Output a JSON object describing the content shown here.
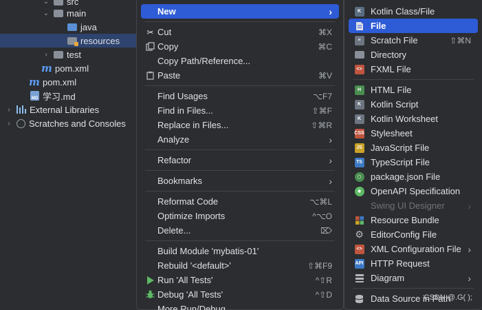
{
  "tree": {
    "items": [
      {
        "label": "src"
      },
      {
        "label": "main"
      },
      {
        "label": "java"
      },
      {
        "label": "resources"
      },
      {
        "label": "test"
      },
      {
        "label": "pom.xml"
      },
      {
        "label": "pom.xml"
      },
      {
        "label": "学习.md"
      },
      {
        "label": "External Libraries"
      },
      {
        "label": "Scratches and Consoles"
      }
    ]
  },
  "menu": {
    "new": {
      "label": "New"
    },
    "cut": {
      "label": "Cut",
      "shortcut": "⌘X"
    },
    "copy": {
      "label": "Copy",
      "shortcut": "⌘C"
    },
    "copy_path": {
      "label": "Copy Path/Reference..."
    },
    "paste": {
      "label": "Paste",
      "shortcut": "⌘V"
    },
    "find_usages": {
      "label": "Find Usages",
      "shortcut": "⌥F7"
    },
    "find_in_files": {
      "label": "Find in Files...",
      "shortcut": "⇧⌘F"
    },
    "replace_in_files": {
      "label": "Replace in Files...",
      "shortcut": "⇧⌘R"
    },
    "analyze": {
      "label": "Analyze"
    },
    "refactor": {
      "label": "Refactor"
    },
    "bookmarks": {
      "label": "Bookmarks"
    },
    "reformat": {
      "label": "Reformat Code",
      "shortcut": "⌥⌘L"
    },
    "optimize": {
      "label": "Optimize Imports",
      "shortcut": "^⌥O"
    },
    "delete": {
      "label": "Delete...",
      "shortcut": "⌦"
    },
    "build_module": {
      "label": "Build Module 'mybatis-01'"
    },
    "rebuild": {
      "label": "Rebuild '<default>'",
      "shortcut": "⇧⌘F9"
    },
    "run_tests": {
      "label": "Run 'All Tests'",
      "shortcut": "^⇧R"
    },
    "debug_tests": {
      "label": "Debug 'All Tests'",
      "shortcut": "^⇧D"
    },
    "more_run": {
      "label": "More Run/Debug"
    }
  },
  "submenu": {
    "kotlin_class": {
      "label": "Kotlin Class/File"
    },
    "file": {
      "label": "File"
    },
    "scratch": {
      "label": "Scratch File",
      "shortcut": "⇧⌘N"
    },
    "directory": {
      "label": "Directory"
    },
    "fxml": {
      "label": "FXML File"
    },
    "html": {
      "label": "HTML File"
    },
    "kotlin_script": {
      "label": "Kotlin Script"
    },
    "kotlin_worksheet": {
      "label": "Kotlin Worksheet"
    },
    "stylesheet": {
      "label": "Stylesheet"
    },
    "javascript": {
      "label": "JavaScript File"
    },
    "typescript": {
      "label": "TypeScript File"
    },
    "package_json": {
      "label": "package.json File"
    },
    "openapi": {
      "label": "OpenAPI Specification"
    },
    "swing": {
      "label": "Swing UI Designer"
    },
    "resource_bundle": {
      "label": "Resource Bundle"
    },
    "editorconfig": {
      "label": "EditorConfig File"
    },
    "xml_config": {
      "label": "XML Configuration File"
    },
    "http_request": {
      "label": "HTTP Request"
    },
    "diagram": {
      "label": "Diagram"
    },
    "data_source": {
      "label": "Data Source in Path"
    }
  },
  "watermark": "CSDN @.G( );",
  "colors": {
    "highlight": "#2e5bd6",
    "selected_row": "#2e436e",
    "background": "#2b2d30"
  }
}
